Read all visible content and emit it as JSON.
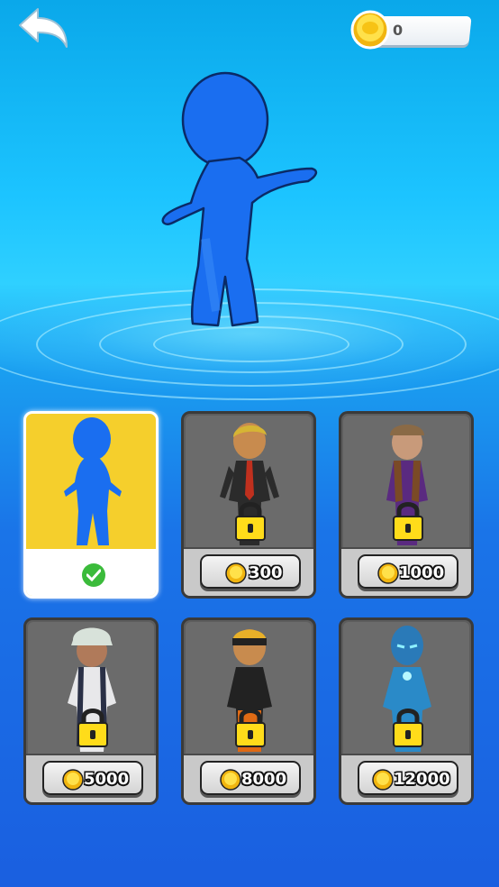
{
  "hud": {
    "coins": "0",
    "icons": {
      "back": "back-arrow-icon",
      "coin": "coin-icon"
    }
  },
  "hero": {
    "skin": "blue-stickman",
    "color": "#1a6ef0"
  },
  "shop": {
    "items": [
      {
        "name": "blue-stickman",
        "state": "selected",
        "price": "",
        "icon": "check-icon"
      },
      {
        "name": "suit-blonde",
        "state": "locked",
        "price": "300",
        "icon": "lock-icon"
      },
      {
        "name": "vest-hat",
        "state": "locked",
        "price": "1000",
        "icon": "lock-icon"
      },
      {
        "name": "marine-officer",
        "state": "locked",
        "price": "5000",
        "icon": "lock-icon"
      },
      {
        "name": "orange-ninja",
        "state": "locked",
        "price": "8000",
        "icon": "lock-icon"
      },
      {
        "name": "blue-armor",
        "state": "locked",
        "price": "12000",
        "icon": "lock-icon"
      }
    ]
  },
  "colors": {
    "selected_card": "#f5cf2c",
    "locked_card": "#5d5d5d",
    "coin": "#f7d11a",
    "check": "#3bbb3b"
  }
}
